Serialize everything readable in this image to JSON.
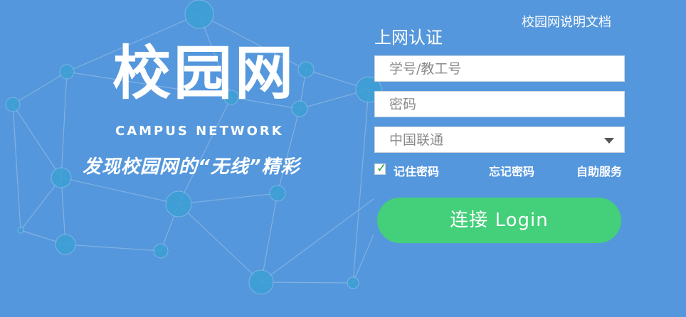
{
  "brand": {
    "title": "校园网",
    "subtitle": "CAMPUS NETWORK",
    "slogan": "发现校园网的“无线”精彩"
  },
  "header": {
    "doc_link": "校园网说明文档"
  },
  "form": {
    "title": "上网认证",
    "username_placeholder": "学号/教工号",
    "password_placeholder": "密码",
    "isp_selected": "中国联通",
    "remember_checked": true,
    "remember_label": "记住密码",
    "forgot_link": "忘记密码",
    "selfservice_link": "自助服务",
    "login_button": "连接 Login"
  },
  "colors": {
    "background": "#5597dc",
    "button": "#44cf7a",
    "network_node": "#3c9fd4",
    "network_line": "#8fb9e6"
  }
}
